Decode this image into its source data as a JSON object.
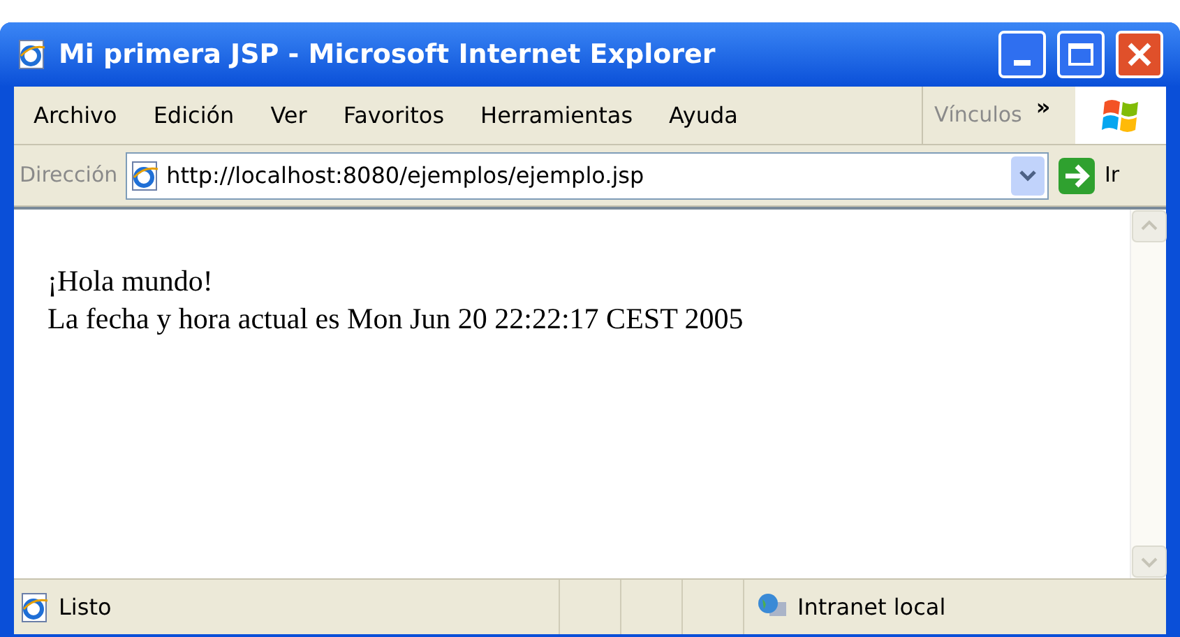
{
  "window": {
    "title": "Mi primera JSP - Microsoft Internet Explorer"
  },
  "menu": [
    {
      "label": "Archivo"
    },
    {
      "label": "Edición"
    },
    {
      "label": "Ver"
    },
    {
      "label": "Favoritos"
    },
    {
      "label": "Herramientas"
    },
    {
      "label": "Ayuda"
    }
  ],
  "links": {
    "label": "Vínculos",
    "chevron": "»"
  },
  "address_bar": {
    "label": "Dirección",
    "value": "http://localhost:8080/ejemplos/ejemplo.jsp",
    "go": "Ir"
  },
  "content": {
    "lines": [
      "¡Hola mundo!",
      "La fecha y hora actual es Mon Jun 20 22:22:17 CEST 2005"
    ]
  },
  "status_bar": {
    "text": "Listo",
    "zone": "Intranet local"
  }
}
